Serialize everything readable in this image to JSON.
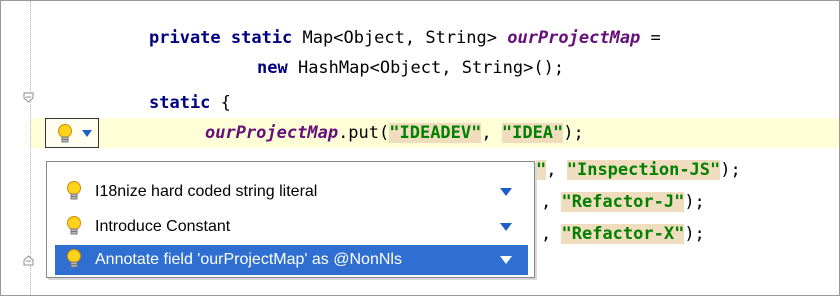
{
  "editor": {
    "lines": [
      {
        "segments": [
          {
            "text": "private static ",
            "cls": "kw"
          },
          {
            "text": "Map<Object, String> ",
            "cls": ""
          },
          {
            "text": "ourProjectMap",
            "cls": "field"
          },
          {
            "text": " =",
            "cls": ""
          }
        ]
      },
      {
        "segments": [
          {
            "text": "new ",
            "cls": "kw"
          },
          {
            "text": "HashMap<Object, String>();",
            "cls": ""
          }
        ]
      },
      {
        "segments": [
          {
            "text": "static ",
            "cls": "kw"
          },
          {
            "text": "{",
            "cls": ""
          }
        ]
      },
      {
        "segments": [
          {
            "text": "ourProjectMap",
            "cls": "field"
          },
          {
            "text": ".put(",
            "cls": ""
          },
          {
            "text": "\"IDEADEV\"",
            "cls": "str hl"
          },
          {
            "text": ", ",
            "cls": ""
          },
          {
            "text": "\"IDEA\"",
            "cls": "str hl"
          },
          {
            "text": ");",
            "cls": ""
          }
        ]
      },
      {
        "segments": [
          {
            "text": "\"",
            "cls": "str hl"
          },
          {
            "text": ", ",
            "cls": ""
          },
          {
            "text": "\"Inspection-JS\"",
            "cls": "str hl"
          },
          {
            "text": ");",
            "cls": ""
          }
        ]
      },
      {
        "segments": [
          {
            "text": ", ",
            "cls": ""
          },
          {
            "text": "\"Refactor-J\"",
            "cls": "str hl"
          },
          {
            "text": ");",
            "cls": ""
          }
        ]
      },
      {
        "segments": [
          {
            "text": ", ",
            "cls": ""
          },
          {
            "text": "\"Refactor-X\"",
            "cls": "str hl"
          },
          {
            "text": ");",
            "cls": ""
          }
        ]
      }
    ]
  },
  "intention_popup": {
    "items": [
      {
        "label": "I18nize hard coded string literal",
        "icon": "lightbulb-icon",
        "selected": false
      },
      {
        "label": "Introduce Constant",
        "icon": "lightbulb-icon",
        "selected": false
      },
      {
        "label": "Annotate field 'ourProjectMap' as @NonNls",
        "icon": "lightbulb-icon",
        "selected": true
      }
    ]
  },
  "colors": {
    "keyword": "#000080",
    "field": "#660e7a",
    "string": "#008000",
    "string_highlight": "#f0dcbf",
    "caret_row": "#ffffd7",
    "selection": "#2f6fd1"
  }
}
